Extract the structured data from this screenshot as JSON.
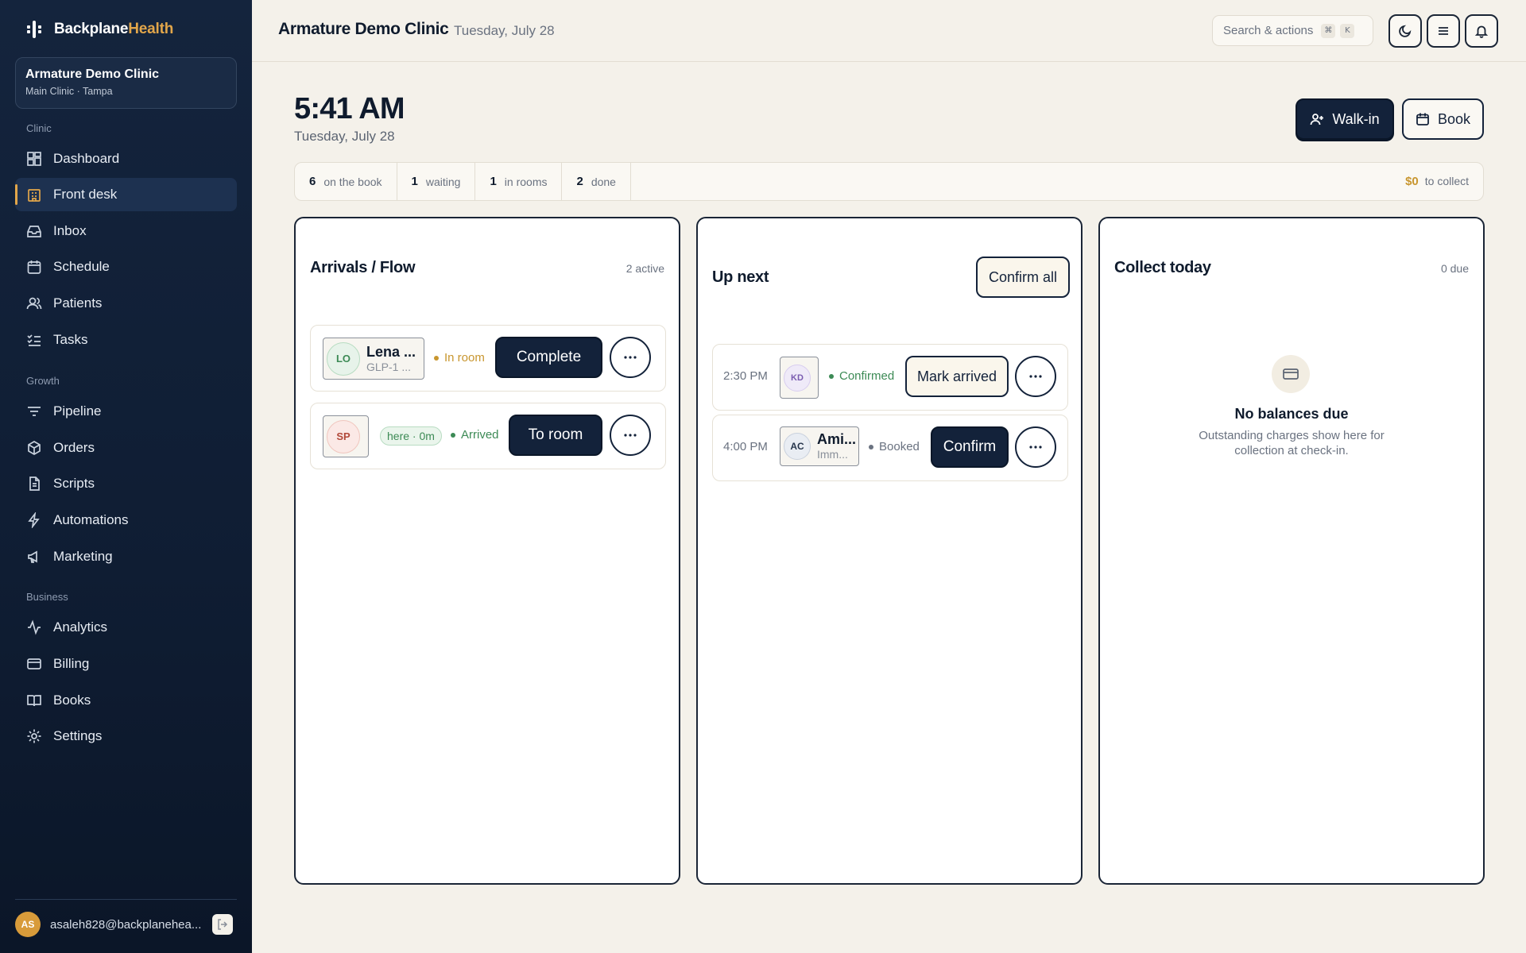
{
  "brand": {
    "name_primary": "Backplane",
    "name_accent": "Health"
  },
  "clinic_switcher": {
    "name": "Armature Demo Clinic",
    "location": "Main Clinic · Tampa"
  },
  "nav": {
    "sections": {
      "clinic": "Clinic",
      "growth": "Growth",
      "business": "Business"
    },
    "items": {
      "dashboard": "Dashboard",
      "front_desk": "Front desk",
      "inbox": "Inbox",
      "schedule": "Schedule",
      "patients": "Patients",
      "tasks": "Tasks",
      "pipeline": "Pipeline",
      "orders": "Orders",
      "scripts": "Scripts",
      "automations": "Automations",
      "marketing": "Marketing",
      "analytics": "Analytics",
      "billing": "Billing",
      "books": "Books",
      "settings": "Settings"
    },
    "active": "front_desk"
  },
  "user": {
    "initials": "AS",
    "email": "asaleh828@backplanehea..."
  },
  "topbar": {
    "title": "Armature Demo Clinic",
    "date": "Tuesday, July 28",
    "search_placeholder": "Search & actions",
    "kbd_1": "⌘",
    "kbd_2": "K"
  },
  "header": {
    "time": "5:41 AM",
    "date": "Tuesday, July 28",
    "walkin_label": "Walk-in",
    "book_label": "Book"
  },
  "stats": [
    {
      "n": "6",
      "label": "on the book"
    },
    {
      "n": "1",
      "label": "waiting"
    },
    {
      "n": "1",
      "label": "in rooms"
    },
    {
      "n": "2",
      "label": "done"
    }
  ],
  "collect": {
    "amount": "$0",
    "label": "to collect"
  },
  "arrivals": {
    "title": "Arrivals / Flow",
    "meta": "2 active",
    "rows": [
      {
        "initials": "LO",
        "name": "Lena ...",
        "sub": "GLP-1 ...",
        "status": "In room",
        "status_color": "#c8962f",
        "action": "Complete"
      },
      {
        "initials": "SP",
        "here": "here · 0m",
        "status": "Arrived",
        "status_color": "#3c8a55",
        "action": "To room"
      }
    ]
  },
  "up_next": {
    "title": "Up next",
    "confirm_all": "Confirm all",
    "rows": [
      {
        "time": "2:30 PM",
        "initials": "KD",
        "status": "Confirmed",
        "status_color": "#3c8a55",
        "action": "Mark arrived"
      },
      {
        "time": "4:00 PM",
        "initials": "AC",
        "name": "Ami...",
        "sub": "Imm...",
        "status": "Booked",
        "status_color": "#6a7280",
        "action": "Confirm"
      }
    ]
  },
  "collect_today": {
    "title": "Collect today",
    "meta": "0 due",
    "empty_title": "No balances due",
    "empty_text": "Outstanding charges show here for collection at check-in."
  },
  "colors": {
    "accent": "#e2a64a",
    "navy": "#13223a",
    "background": "#f4f1ea"
  },
  "icons": {
    "theme": "moon-icon",
    "menu": "menu-icon",
    "notifications": "bell-icon",
    "walkin": "user-plus-icon",
    "book": "calendar-icon",
    "empty": "credit-card-icon"
  }
}
